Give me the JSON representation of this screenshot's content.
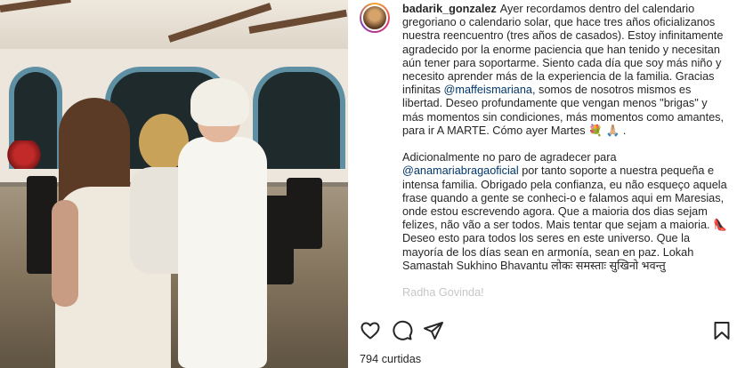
{
  "post": {
    "username": "badarik_gonzalez",
    "caption": {
      "p1_text1": "Ayer recordamos dentro del calendario gregoriano o calendario solar, que hace tres años oficializanos nuestra reencuentro (tres años de casados). Estoy infinitamente agradecido por la enorme paciencia que han tenido y necesitan aún tener para soportarme. Siento cada día que soy más niño y necesito aprender más de la experiencia de la familia. Gracias infinitas ",
      "p1_mention": "@maffeismariana",
      "p1_text2": ", somos de nosotros mismos es libertad. Deseo profundamente que vengan menos \"brigas\" y más momentos sin condiciones, más momentos como amantes, para ir A MARTE. Cómo ayer Martes 💐 🙏🏼 .",
      "p2_text1": "Adicionalmente no paro de agradecer para ",
      "p2_mention": "@anamariabragaoficial",
      "p2_text2": " por tanto soporte a nuestra pequeña e intensa familia. Obrigado pela confianza, eu não esqueço aquela frase quando a gente se conheci-o e falamos aqui em Maresias, onde estou escrevendo agora. Que a maioria dos dias sejam felizes, não vão a ser todos. Mais tentar que sejam a maioria. 👠 Deseo esto para todos los seres en este universo. Que la mayoría de los días sean en armonía, sean en paz. Lokah Samastah Sukhino Bhavantu लोकः समस्ताः सुखिनो भवन्तु",
      "p3_faded": "Radha Govinda!"
    },
    "likes": "794 curtidas"
  },
  "icons": {
    "like": "heart-icon",
    "comment": "comment-icon",
    "share": "send-icon",
    "save": "bookmark-icon"
  },
  "colors": {
    "mention": "#00376b",
    "text": "#262626"
  }
}
